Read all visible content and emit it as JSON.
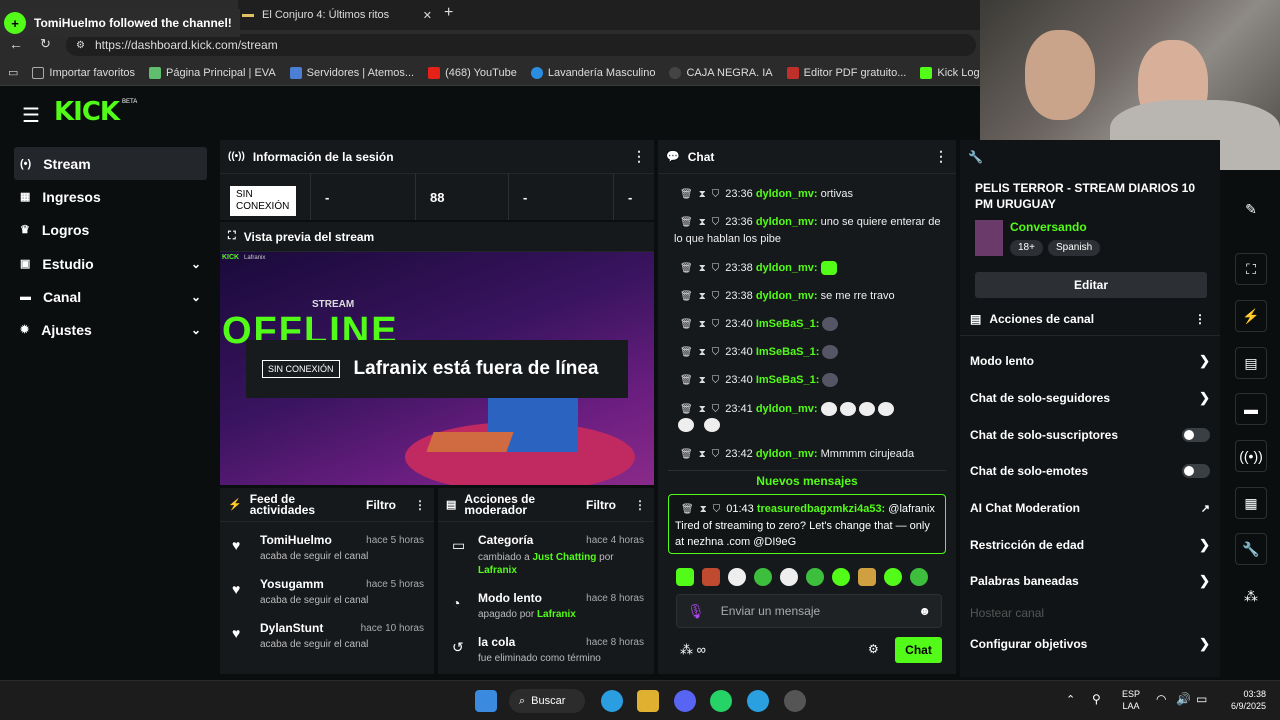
{
  "notification": "TomiHuelmo followed the channel!",
  "browser": {
    "tab2": "El Conjuro 4: Últimos ritos",
    "url": "https://dashboard.kick.com/stream",
    "bookmarks": [
      "Importar favoritos",
      "Página Principal | EVA",
      "Servidores | Atemos...",
      "(468) YouTube",
      "Lavandería Masculino",
      "CAJA NEGRA. IA",
      "Editor PDF gratuito...",
      "Kick Logo"
    ]
  },
  "logo": {
    "text": "KICK",
    "badge": "BETA"
  },
  "nav": [
    {
      "label": "Stream",
      "icon": "stream-icon"
    },
    {
      "label": "Ingresos",
      "icon": "revenue-icon"
    },
    {
      "label": "Logros",
      "icon": "trophy-icon"
    },
    {
      "label": "Estudio",
      "icon": "studio-icon"
    },
    {
      "label": "Canal",
      "icon": "channel-icon"
    },
    {
      "label": "Ajustes",
      "icon": "settings-icon"
    }
  ],
  "session": {
    "title": "Información de la sesión",
    "status": "SIN CONEXIÓN",
    "stats": [
      "-",
      "88",
      "-",
      "-"
    ]
  },
  "preview": {
    "title": "Vista previa del stream",
    "badge": "SIN CONEXIÓN",
    "message": "Lafranix está fuera de línea",
    "small_logo": "KICK",
    "small_name": "Lafranix",
    "stream_word": "STREAM",
    "offline_word": "OFFLINE"
  },
  "feed": {
    "title": "Feed de actividades",
    "filter": "Filtro",
    "items": [
      {
        "name": "TomiHuelmo",
        "sub": "acaba de seguir el canal",
        "time": "hace 5 horas"
      },
      {
        "name": "Yosugamm",
        "sub": "acaba de seguir el canal",
        "time": "hace 5 horas"
      },
      {
        "name": "DylanStunt",
        "sub": "acaba de seguir el canal",
        "time": "hace 10 horas"
      }
    ]
  },
  "modactions": {
    "title": "Acciones de moderador",
    "filter": "Filtro",
    "items": [
      {
        "name": "Categoría",
        "time": "hace 4 horas",
        "pre": "cambiado a ",
        "hl": "Just Chatting",
        "mid": " por ",
        "hl2": "Lafranix"
      },
      {
        "name": "Modo lento",
        "time": "hace 8 horas",
        "pre": "apagado por ",
        "hl": "Lafranix",
        "mid": "",
        "hl2": ""
      },
      {
        "name": "la cola",
        "time": "hace 8 horas",
        "pre": "fue eliminado como término",
        "hl": "",
        "mid": "",
        "hl2": ""
      }
    ]
  },
  "chat": {
    "title": "Chat",
    "messages": [
      {
        "time": "23:36",
        "user": "dyldon_mv:",
        "text": "ortivas"
      },
      {
        "time": "23:36",
        "user": "dyldon_mv:",
        "text": "uno se quiere enterar de lo que hablan los pibe"
      },
      {
        "time": "23:38",
        "user": "dyldon_mv:",
        "text": ""
      },
      {
        "time": "23:38",
        "user": "dyldon_mv:",
        "text": "se me rre travo"
      },
      {
        "time": "23:40",
        "user": "ImSeBaS_1:",
        "text": ""
      },
      {
        "time": "23:40",
        "user": "ImSeBaS_1:",
        "text": ""
      },
      {
        "time": "23:40",
        "user": "ImSeBaS_1:",
        "text": ""
      },
      {
        "time": "23:41",
        "user": "dyldon_mv:",
        "text": ""
      },
      {
        "time": "23:42",
        "user": "dyldon_mv:",
        "text": "Mmmmm cirujeada"
      }
    ],
    "new_messages": "Nuevos mensajes",
    "pinned": {
      "time": "01:43",
      "user": "treasuredbagxmkzi4a53:",
      "text": "@lafranix Tired of streaming to zero? Let's change that — only at nezhna .com @DI9eG"
    },
    "input_placeholder": "Enviar un mensaje",
    "send": "Chat"
  },
  "stream_info": {
    "title": "PELIS TERROR - STREAM DIARIOS 10 PM URUGUAY",
    "category": "Conversando",
    "tags": [
      "18+",
      "Spanish"
    ],
    "edit": "Editar"
  },
  "channel_actions": {
    "title": "Acciones de canal",
    "items": [
      {
        "label": "Modo lento",
        "control": "chevron"
      },
      {
        "label": "Chat de solo-seguidores",
        "control": "chevron"
      },
      {
        "label": "Chat de solo-suscriptores",
        "control": "toggle"
      },
      {
        "label": "Chat de solo-emotes",
        "control": "toggle"
      },
      {
        "label": "AI Chat Moderation",
        "control": "external"
      },
      {
        "label": "Restricción de edad",
        "control": "chevron"
      },
      {
        "label": "Palabras baneadas",
        "control": "chevron"
      },
      {
        "label": "Hostear canal",
        "control": "none"
      },
      {
        "label": "Configurar objetivos",
        "control": "chevron"
      }
    ]
  },
  "taskbar": {
    "search": "Buscar",
    "lang1": "ESP",
    "lang2": "LAA",
    "time": "03:38",
    "date": "6/9/2025"
  },
  "colors": {
    "accent": "#53fc18",
    "bg": "#0b0e0f",
    "panel": "#16191c"
  }
}
